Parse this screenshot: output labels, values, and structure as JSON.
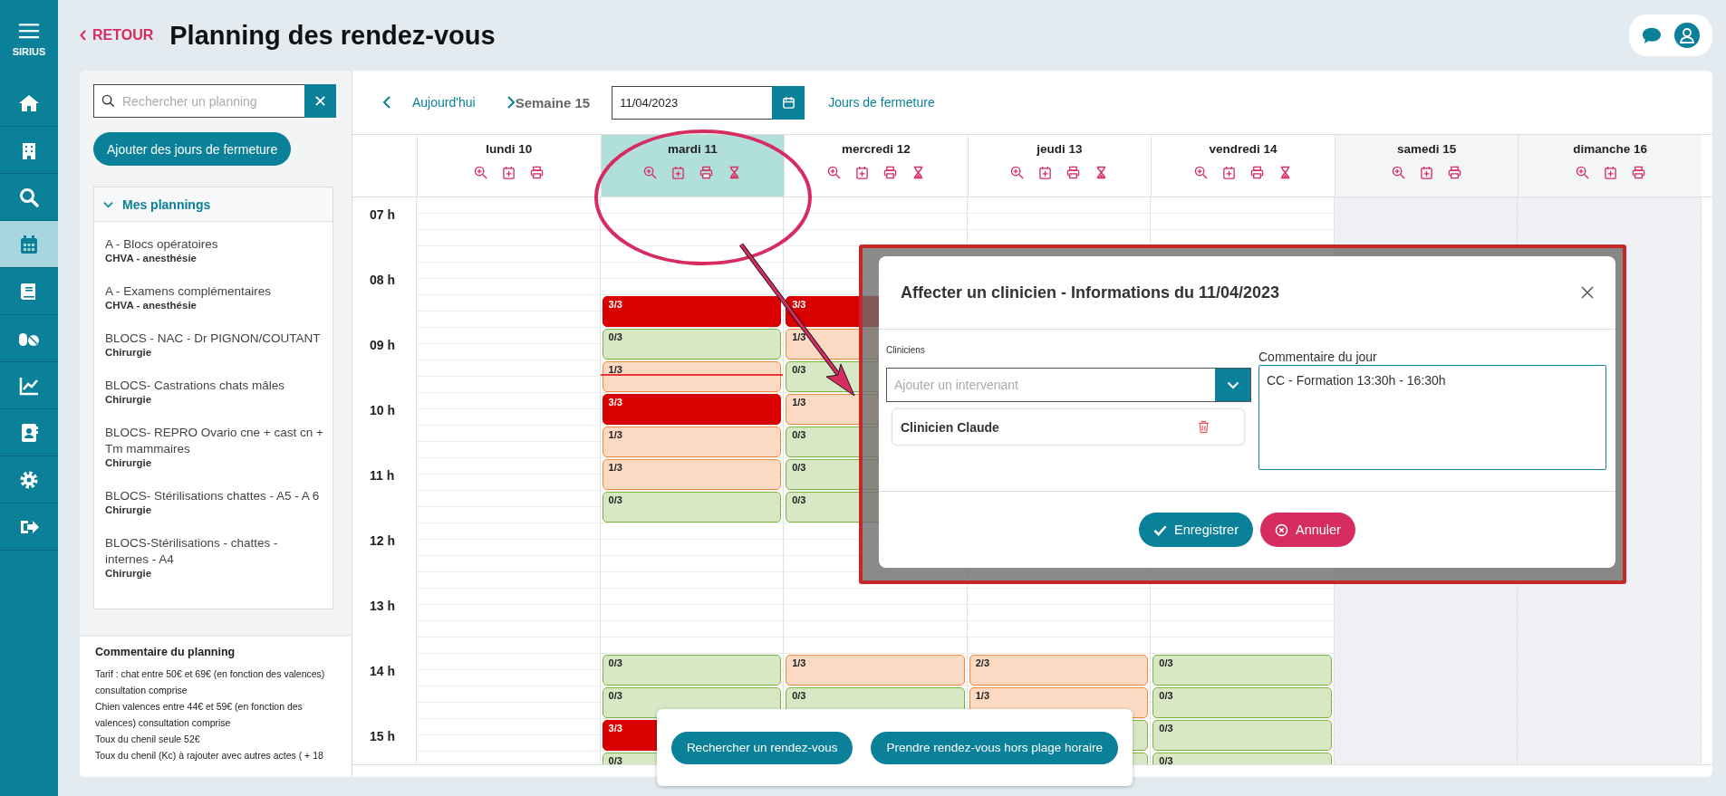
{
  "nav": {
    "brand": "SIRIUS",
    "items": [
      {
        "selected": false
      },
      {
        "selected": false
      },
      {
        "selected": false
      },
      {
        "selected": true
      },
      {
        "selected": false
      },
      {
        "selected": false
      },
      {
        "selected": false
      },
      {
        "selected": false
      },
      {
        "selected": false
      },
      {
        "selected": false
      }
    ]
  },
  "header": {
    "back": "RETOUR",
    "title": "Planning des rendez-vous"
  },
  "planning_panel": {
    "search": {
      "placeholder": "Rechercher un planning"
    },
    "add_button": "Ajouter des jours de fermeture",
    "section": {
      "title": "Mes plannings",
      "expanded": true,
      "items": [
        {
          "title": "A - Blocs opératoires",
          "subtitle": "CHVA - anesthésie"
        },
        {
          "title": "A - Examens complémentaires",
          "subtitle": "CHVA - anesthésie"
        },
        {
          "title": "BLOCS - NAC - Dr PIGNON/COUTANT",
          "subtitle": "Chirurgie"
        },
        {
          "title": "BLOCS- Castrations chats mâles",
          "subtitle": "Chirurgie"
        },
        {
          "title": "BLOCS- REPRO Ovario cne + cast cn + Tm mammaires",
          "subtitle": "Chirurgie"
        },
        {
          "title": "BLOCS- Stérilisations chattes - A5 - A 6",
          "subtitle": "Chirurgie"
        },
        {
          "title": "BLOCS-Stérilisations - chattes - internes - A4",
          "subtitle": "Chirurgie"
        }
      ]
    },
    "comment": {
      "title": "Commentaire du planning",
      "lines": [
        "Tarif : chat entre 50€ et 69€ (en fonction des valences) consultation comprise",
        "Chien valences entre 44€ et 59€ (en fonction des valences) consultation comprise",
        "Toux du chenil seule 52€",
        "Toux du chenil (Kc) à rajouter avec autres actes ( + 18"
      ]
    }
  },
  "calendar": {
    "today": "Aujourd'hui",
    "week": "Semaine 15",
    "date": "11/04/2023",
    "closures_link": "Jours de fermeture",
    "hours": [
      "07 h",
      "08 h",
      "09 h",
      "10 h",
      "11 h",
      "12 h",
      "13 h",
      "14 h",
      "15 h"
    ],
    "days": [
      {
        "label": "lundi 10",
        "selected": false,
        "weekend": false,
        "waitlist": false,
        "now_line": false
      },
      {
        "label": "mardi 11",
        "selected": true,
        "weekend": false,
        "waitlist": true,
        "now_line": true,
        "slots": [
          {
            "kind": "none"
          },
          {
            "kind": "none"
          },
          {
            "kind": "none"
          },
          {
            "kind": "full",
            "count": "3/3"
          },
          {
            "kind": "free",
            "count": "0/3"
          },
          {
            "kind": "partial",
            "count": "1/3"
          },
          {
            "kind": "full",
            "count": "3/3"
          },
          {
            "kind": "partial",
            "count": "1/3"
          },
          {
            "kind": "partial",
            "count": "1/3"
          },
          {
            "kind": "free",
            "count": "0/3"
          },
          {
            "kind": "none"
          },
          {
            "kind": "none"
          },
          {
            "kind": "none"
          },
          {
            "kind": "none"
          },
          {
            "kind": "free",
            "count": "0/3"
          },
          {
            "kind": "free",
            "count": "0/3"
          },
          {
            "kind": "full",
            "count": "3/3"
          },
          {
            "kind": "free",
            "count": "0/3"
          }
        ]
      },
      {
        "label": "mercredi 12",
        "selected": false,
        "weekend": false,
        "waitlist": true,
        "now_line": false,
        "slots": [
          {
            "kind": "none"
          },
          {
            "kind": "none"
          },
          {
            "kind": "none"
          },
          {
            "kind": "full",
            "count": "3/3"
          },
          {
            "kind": "partial",
            "count": "1/3"
          },
          {
            "kind": "free",
            "count": "0/3"
          },
          {
            "kind": "partial",
            "count": "1/3"
          },
          {
            "kind": "free",
            "count": "0/3"
          },
          {
            "kind": "free",
            "count": "0/3"
          },
          {
            "kind": "free",
            "count": "0/3"
          },
          {
            "kind": "none"
          },
          {
            "kind": "none"
          },
          {
            "kind": "none"
          },
          {
            "kind": "none"
          },
          {
            "kind": "partial",
            "count": "1/3"
          },
          {
            "kind": "free",
            "count": "0/3"
          }
        ]
      },
      {
        "label": "jeudi 13",
        "selected": false,
        "weekend": false,
        "waitlist": true,
        "now_line": false,
        "slots": [
          {
            "kind": "none"
          },
          {
            "kind": "none"
          },
          {
            "kind": "none"
          },
          {
            "kind": "none"
          },
          {
            "kind": "none"
          },
          {
            "kind": "none"
          },
          {
            "kind": "none"
          },
          {
            "kind": "none"
          },
          {
            "kind": "none"
          },
          {
            "kind": "none"
          },
          {
            "kind": "none"
          },
          {
            "kind": "none"
          },
          {
            "kind": "none"
          },
          {
            "kind": "none"
          },
          {
            "kind": "partial",
            "count": "2/3"
          },
          {
            "kind": "partial",
            "count": "1/3"
          },
          {
            "kind": "free"
          },
          {
            "kind": "free"
          }
        ]
      },
      {
        "label": "vendredi 14",
        "selected": false,
        "weekend": false,
        "waitlist": true,
        "now_line": false,
        "slots": [
          {
            "kind": "none"
          },
          {
            "kind": "none"
          },
          {
            "kind": "none"
          },
          {
            "kind": "none"
          },
          {
            "kind": "none"
          },
          {
            "kind": "none"
          },
          {
            "kind": "none"
          },
          {
            "kind": "none"
          },
          {
            "kind": "none"
          },
          {
            "kind": "none"
          },
          {
            "kind": "none"
          },
          {
            "kind": "none"
          },
          {
            "kind": "none"
          },
          {
            "kind": "none"
          },
          {
            "kind": "free",
            "count": "0/3"
          },
          {
            "kind": "free",
            "count": "0/3"
          },
          {
            "kind": "free",
            "count": "0/3"
          },
          {
            "kind": "free",
            "count": "0/3"
          }
        ]
      },
      {
        "label": "samedi 15",
        "selected": false,
        "weekend": true,
        "waitlist": false,
        "now_line": false
      },
      {
        "label": "dimanche 16",
        "selected": false,
        "weekend": true,
        "waitlist": false,
        "now_line": false
      }
    ]
  },
  "actions": [
    "Rechercher un rendez-vous",
    "Prendre rendez-vous hors plage horaire"
  ],
  "modal": {
    "title": "Affecter un clinicien - Informations du 11/04/2023",
    "clinicians_label": "Cliniciens",
    "select_placeholder": "Ajouter un intervenant",
    "clinicians": [
      "Clinicien Claude"
    ],
    "comment_label": "Commentaire du jour",
    "comment": "CC - Formation 13:30h - 16:30h",
    "buttons": [
      {
        "label": "Enregistrer",
        "kind": "save"
      },
      {
        "label": "Annuler",
        "kind": "cancel"
      }
    ]
  }
}
